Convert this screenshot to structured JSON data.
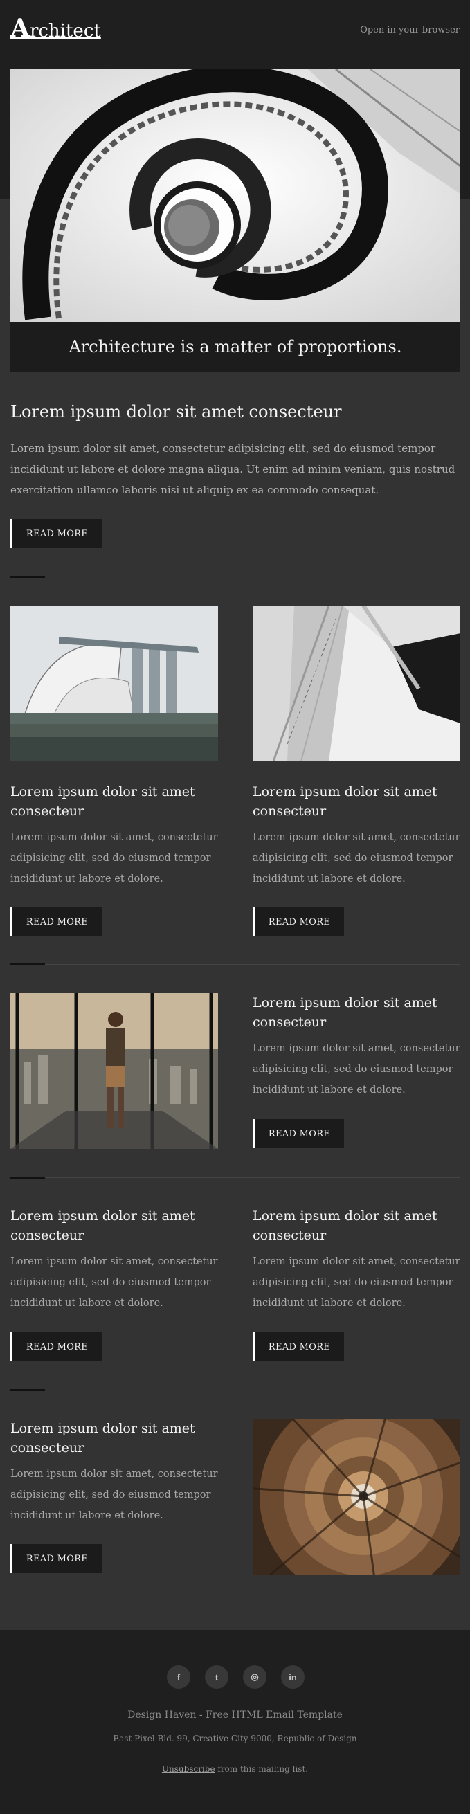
{
  "header": {
    "logo_initial": "A",
    "logo_rest": "rchitect",
    "open_in_browser": "Open in your browser"
  },
  "hero": {
    "caption": "Architecture is a matter of proportions."
  },
  "intro": {
    "title": "Lorem ipsum dolor sit amet consecteur",
    "text": "Lorem ipsum dolor sit amet, consectetur adipisicing elit, sed do eiusmod tempor incididunt ut labore et dolore magna aliqua. Ut enim ad minim veniam, quis nostrud exercitation ullamco laboris nisi ut aliquip ex ea commodo consequat.",
    "button": "READ MORE"
  },
  "cards": [
    {
      "title": "Lorem ipsum dolor sit amet consecteur",
      "text": "Lorem ipsum dolor sit amet, consectetur adipisicing elit, sed do eiusmod tempor incididunt ut labore et dolore.",
      "button": "READ MORE"
    },
    {
      "title": "Lorem ipsum dolor sit amet consecteur",
      "text": "Lorem ipsum dolor sit amet, consectetur adipisicing elit, sed do eiusmod tempor incididunt ut labore et dolore.",
      "button": "READ MORE"
    },
    {
      "title": "Lorem ipsum dolor sit amet consecteur",
      "text": "Lorem ipsum dolor sit amet, consectetur adipisicing elit, sed do eiusmod tempor incididunt ut labore et dolore.",
      "button": "READ MORE"
    },
    {
      "title": "Lorem ipsum dolor sit amet consecteur",
      "text": "Lorem ipsum dolor sit amet, consectetur adipisicing elit, sed do eiusmod tempor incididunt ut labore et dolore.",
      "button": "READ MORE"
    },
    {
      "title": "Lorem ipsum dolor sit amet consecteur",
      "text": "Lorem ipsum dolor sit amet, consectetur adipisicing elit, sed do eiusmod tempor incididunt ut labore et dolore.",
      "button": "READ MORE"
    },
    {
      "title": "Lorem ipsum dolor sit amet consecteur",
      "text": "Lorem ipsum dolor sit amet, consectetur adipisicing elit, sed do eiusmod tempor incididunt ut labore et dolore.",
      "button": "READ MORE"
    }
  ],
  "footer": {
    "social": [
      {
        "icon": "facebook-icon",
        "glyph": "f"
      },
      {
        "icon": "twitter-icon",
        "glyph": "t"
      },
      {
        "icon": "instagram-icon",
        "glyph": "◎"
      },
      {
        "icon": "linkedin-icon",
        "glyph": "in"
      }
    ],
    "brand": "Design Haven - Free HTML Email Template",
    "address": "East Pixel Bld. 99, Creative City 9000, Republic of Design",
    "unsubscribe": "Unsubscribe",
    "unsubscribe_rest": " from this mailing list."
  },
  "colors": {
    "background": "#333333",
    "header": "#1f1f1f",
    "button": "#1b1b1b",
    "text_muted": "#a9a9a9"
  }
}
